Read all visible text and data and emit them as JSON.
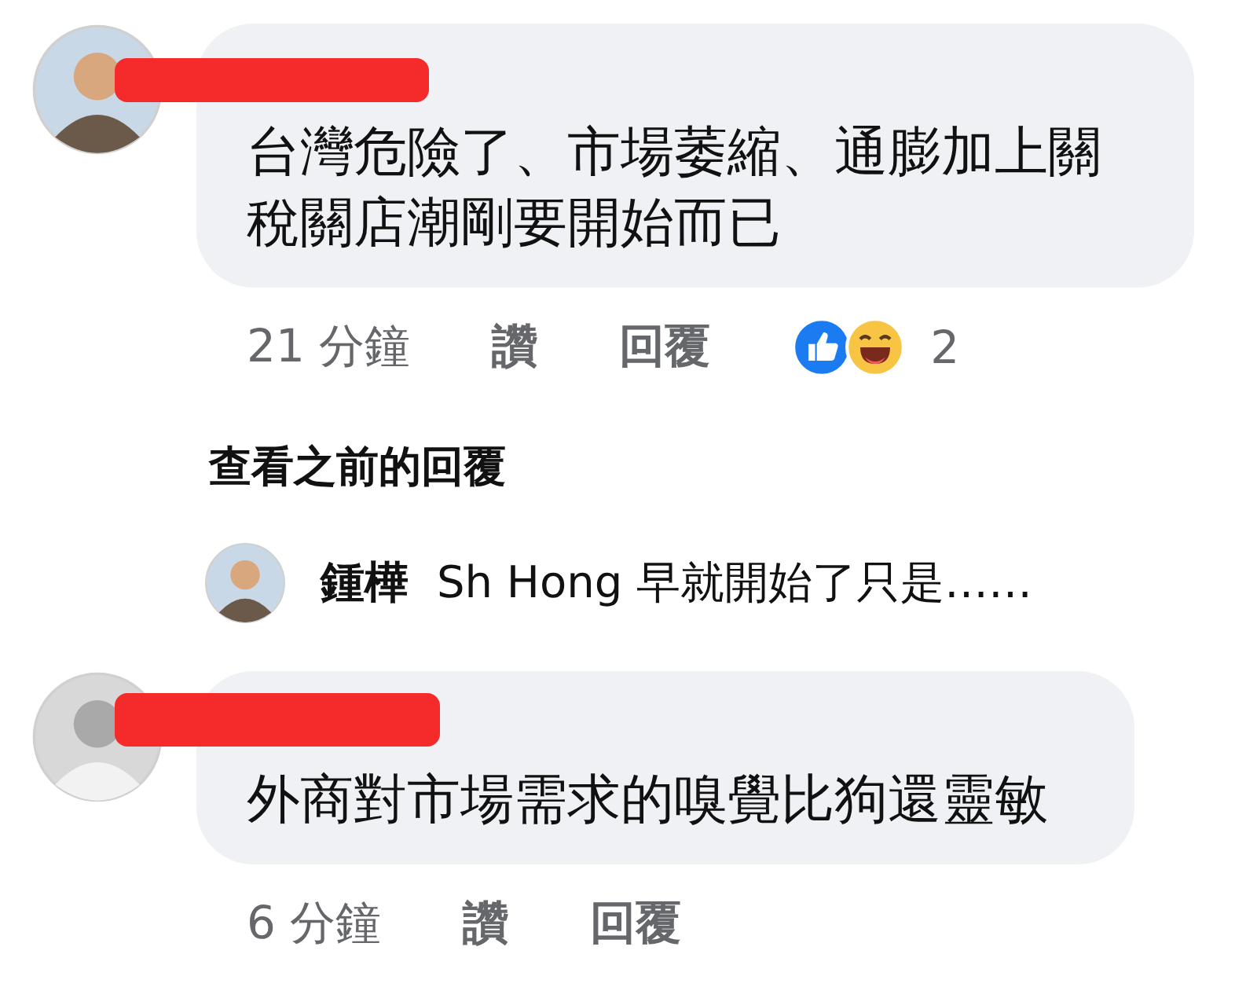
{
  "comments": [
    {
      "text_lines": [
        "台灣危險了、市場萎縮、通膨加上關",
        "稅關店潮剛要開始而已"
      ],
      "redacted": true,
      "time": "21 分鐘",
      "like": "讚",
      "reply": "回覆",
      "reactions": [
        {
          "kind": "like"
        },
        {
          "kind": "haha"
        }
      ],
      "reaction_count": "2"
    },
    {
      "kind": "more-replies",
      "label": "查看之前的回覆"
    },
    {
      "kind": "reply",
      "name": "鍾樺",
      "text": "Sh Hong 早就開始了只是……"
    },
    {
      "text_lines": [
        "外商對市場需求的嗅覺比狗還靈敏"
      ],
      "redacted": true,
      "time": "6 分鐘",
      "like": "讚",
      "reply": "回覆"
    }
  ]
}
